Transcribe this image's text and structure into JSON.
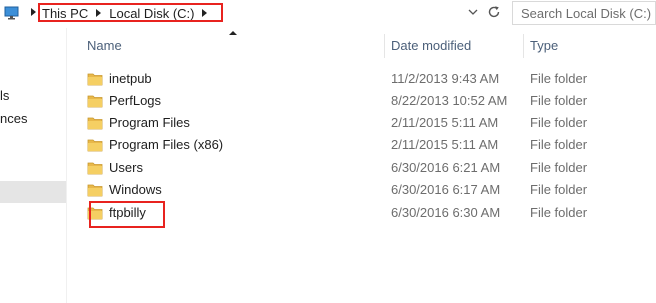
{
  "address_bar": {
    "breadcrumbs": [
      "This PC",
      "Local Disk (C:)"
    ],
    "search_placeholder": "Search Local Disk (C:)"
  },
  "nav": {
    "fragments": [
      "ls",
      "nces"
    ]
  },
  "columns": {
    "name": "Name",
    "date_modified": "Date modified",
    "type": "Type"
  },
  "files": [
    {
      "name": "inetpub",
      "date": "11/2/2013 9:43 AM",
      "type": "File folder"
    },
    {
      "name": "PerfLogs",
      "date": "8/22/2013 10:52 AM",
      "type": "File folder"
    },
    {
      "name": "Program Files",
      "date": "2/11/2015 5:11 AM",
      "type": "File folder"
    },
    {
      "name": "Program Files (x86)",
      "date": "2/11/2015 5:11 AM",
      "type": "File folder"
    },
    {
      "name": "Users",
      "date": "6/30/2016 6:21 AM",
      "type": "File folder"
    },
    {
      "name": "Windows",
      "date": "6/30/2016 6:17 AM",
      "type": "File folder"
    },
    {
      "name": "ftpbilly",
      "date": "6/30/2016 6:30 AM",
      "type": "File folder"
    }
  ],
  "colors": {
    "highlight_border": "#e8231f",
    "header_text": "#4c607a",
    "folder": "#e8b84a"
  },
  "icons": {
    "location": "this-pc-icon",
    "dropdown": "chevron-down-icon",
    "refresh": "refresh-icon",
    "folder": "folder-icon"
  }
}
